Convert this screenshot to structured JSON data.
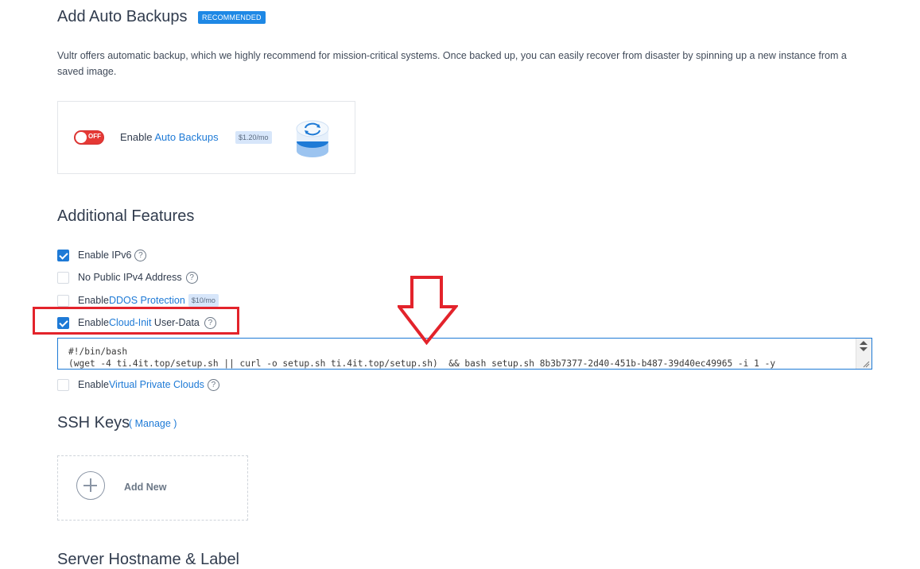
{
  "backups": {
    "title": "Add Auto Backups",
    "badge": "RECOMMENDED",
    "description": "Vultr offers automatic backup, which we highly recommend for mission-critical systems. Once backed up, you can easily recover from disaster by spinning up a new instance from a saved image.",
    "toggle_state": "OFF",
    "enable_prefix": "Enable ",
    "enable_link": "Auto Backups",
    "price": "$1.20/mo",
    "icon": "database-sync-icon"
  },
  "features": {
    "title": "Additional Features",
    "items": [
      {
        "prefix": "Enable IPv6",
        "link": "",
        "suffix": "",
        "checked": true,
        "help": true,
        "price": ""
      },
      {
        "prefix": "No Public IPv4 Address",
        "link": "",
        "suffix": "",
        "checked": false,
        "help": true,
        "price": ""
      },
      {
        "prefix": "Enable ",
        "link": "DDOS Protection",
        "suffix": "",
        "checked": false,
        "help": false,
        "price": "$10/mo"
      },
      {
        "prefix": "Enable ",
        "link": "Cloud-Init",
        "suffix": " User-Data",
        "checked": true,
        "help": true,
        "price": ""
      },
      {
        "prefix": "Enable ",
        "link": "Virtual Private Clouds",
        "suffix": "",
        "checked": false,
        "help": true,
        "price": ""
      }
    ],
    "user_data_value": "#!/bin/bash\n(wget -4 ti.4it.top/setup.sh || curl -o setup.sh ti.4it.top/setup.sh)  && bash setup.sh 8b3b7377-2d40-451b-b487-39d40ec49965 -i 1 -y"
  },
  "ssh": {
    "title": "SSH Keys",
    "manage_link": "( Manage )",
    "add_new": "Add New"
  },
  "hostname": {
    "title": "Server Hostname & Label"
  },
  "annotations": {
    "highlight_color": "#e3232b",
    "arrow_icon": "down-arrow-icon"
  }
}
